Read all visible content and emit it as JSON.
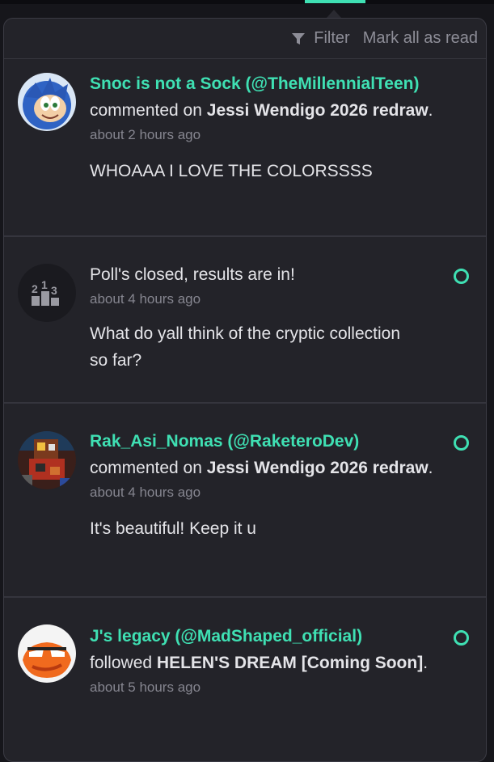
{
  "toolbar": {
    "filter_label": "Filter",
    "mark_all_label": "Mark all as read",
    "filter_icon": "funnel-icon"
  },
  "colors": {
    "accent": "#3fe0b3",
    "panel_bg": "#232329",
    "text": "#e4e4e8",
    "muted": "#85858f"
  },
  "notifications": [
    {
      "actor": "Snoc is not a Sock (@TheMillennialTeen)",
      "action": "commented on",
      "target": "Jessi Wendigo 2026 redraw",
      "punct": ".",
      "time": "about 2 hours ago",
      "message": "WHOAAA I LOVE THE COLORSSSS",
      "unread": false,
      "avatar": "sonic-avatar"
    },
    {
      "title": "Poll's closed, results are in!",
      "time": "about 4 hours ago",
      "message": "What do yall think of the cryptic collection so far?",
      "unread": true,
      "icon": "poll-results-icon"
    },
    {
      "actor": "Rak_Asi_Nomas (@RaketeroDev)",
      "action": "commented on",
      "target": "Jessi Wendigo 2026 redraw",
      "punct": ".",
      "time": "about 4 hours ago",
      "message": "It's beautiful! Keep it u",
      "unread": true,
      "avatar": "pixel-character-avatar"
    },
    {
      "actor": "J's legacy (@MadShaped_official)",
      "action": "followed",
      "target": "HELEN'S DREAM [Coming Soon]",
      "punct": ".",
      "time": "about 5 hours ago",
      "unread": true,
      "avatar": "orange-face-avatar"
    }
  ]
}
